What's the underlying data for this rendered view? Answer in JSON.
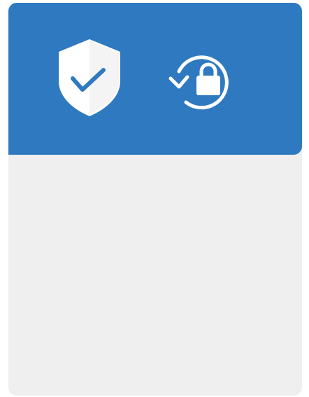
{
  "colors": {
    "header_background": "#2e79c0",
    "body_background": "#efefef",
    "icon_foreground": "#ffffff",
    "check_color": "#2e79c0"
  },
  "header": {
    "icons": [
      "shield-check-icon",
      "restore-lock-icon"
    ]
  }
}
